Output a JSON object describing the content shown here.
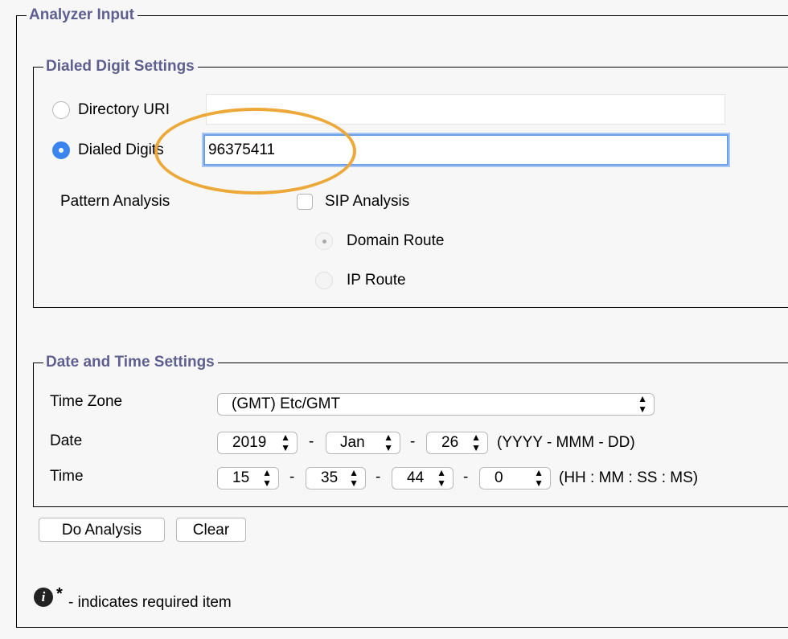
{
  "analyzer_input": {
    "legend": "Analyzer Input"
  },
  "dialed_digit_settings": {
    "legend": "Dialed Digit Settings",
    "directory_uri_label": "Directory URI",
    "directory_uri_value": "",
    "dialed_digits_label": "Dialed Digits",
    "dialed_digits_value": "96375411",
    "selected_mode": "Dialed Digits",
    "pattern_analysis_label": "Pattern Analysis",
    "sip_analysis_label": "SIP Analysis",
    "sip_analysis_checked": false,
    "domain_route_label": "Domain Route",
    "ip_route_label": "IP Route"
  },
  "date_time_settings": {
    "legend": "Date and Time Settings",
    "time_zone_label": "Time Zone",
    "time_zone_value": "(GMT) Etc/GMT",
    "date_label": "Date",
    "date_year": "2019",
    "date_month": "Jan",
    "date_day": "26",
    "date_separator": "-",
    "date_format_hint": "(YYYY - MMM - DD)",
    "time_label": "Time",
    "time_hh": "15",
    "time_mm": "35",
    "time_ss": "44",
    "time_ms": "0",
    "time_separator": "-",
    "time_format_hint": "(HH : MM : SS : MS)"
  },
  "buttons": {
    "do_analysis": "Do Analysis",
    "clear": "Clear"
  },
  "footer": {
    "required_marker": "*",
    "required_note": "- indicates required item"
  },
  "colors": {
    "legend_text": "#5f5f8f",
    "radio_selected": "#3a84f0",
    "highlight": "#eda83a",
    "focus_ring": "#6b9fe8"
  },
  "icons": {
    "info": "info-icon",
    "select_arrows": "updown-arrows-icon"
  }
}
